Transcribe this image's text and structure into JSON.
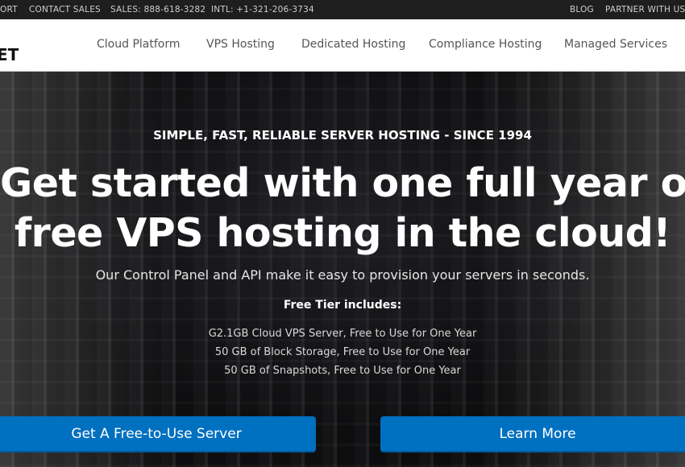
{
  "topbar": {
    "left": [
      "ORT",
      "CONTACT SALES",
      "SALES: 888-618-3282",
      "INTL: +1-321-206-3734"
    ],
    "right": [
      "BLOG",
      "PARTNER WITH US"
    ]
  },
  "logo": "ET",
  "nav": [
    "Cloud Platform",
    "VPS Hosting",
    "Dedicated Hosting",
    "Compliance Hosting",
    "Managed Services"
  ],
  "hero": {
    "tagline": "SIMPLE, FAST, RELIABLE SERVER HOSTING - SINCE 1994",
    "headline_1": "Get started with one full year of",
    "headline_2": "free VPS hosting in the cloud!",
    "subtitle": "Our Control Panel and API make it easy to provision your servers in seconds.",
    "free_tier_title": "Free Tier includes:",
    "free_tier_items": [
      "G2.1GB Cloud VPS Server, Free to Use for One Year",
      "50 GB of Block Storage, Free to Use for One Year",
      "50 GB of Snapshots, Free to Use for One Year"
    ],
    "primary_button": "Get A Free-to-Use Server",
    "secondary_button": "Learn More"
  },
  "colors": {
    "accent": "#0070c0",
    "topbar": "#1e1e1e"
  }
}
